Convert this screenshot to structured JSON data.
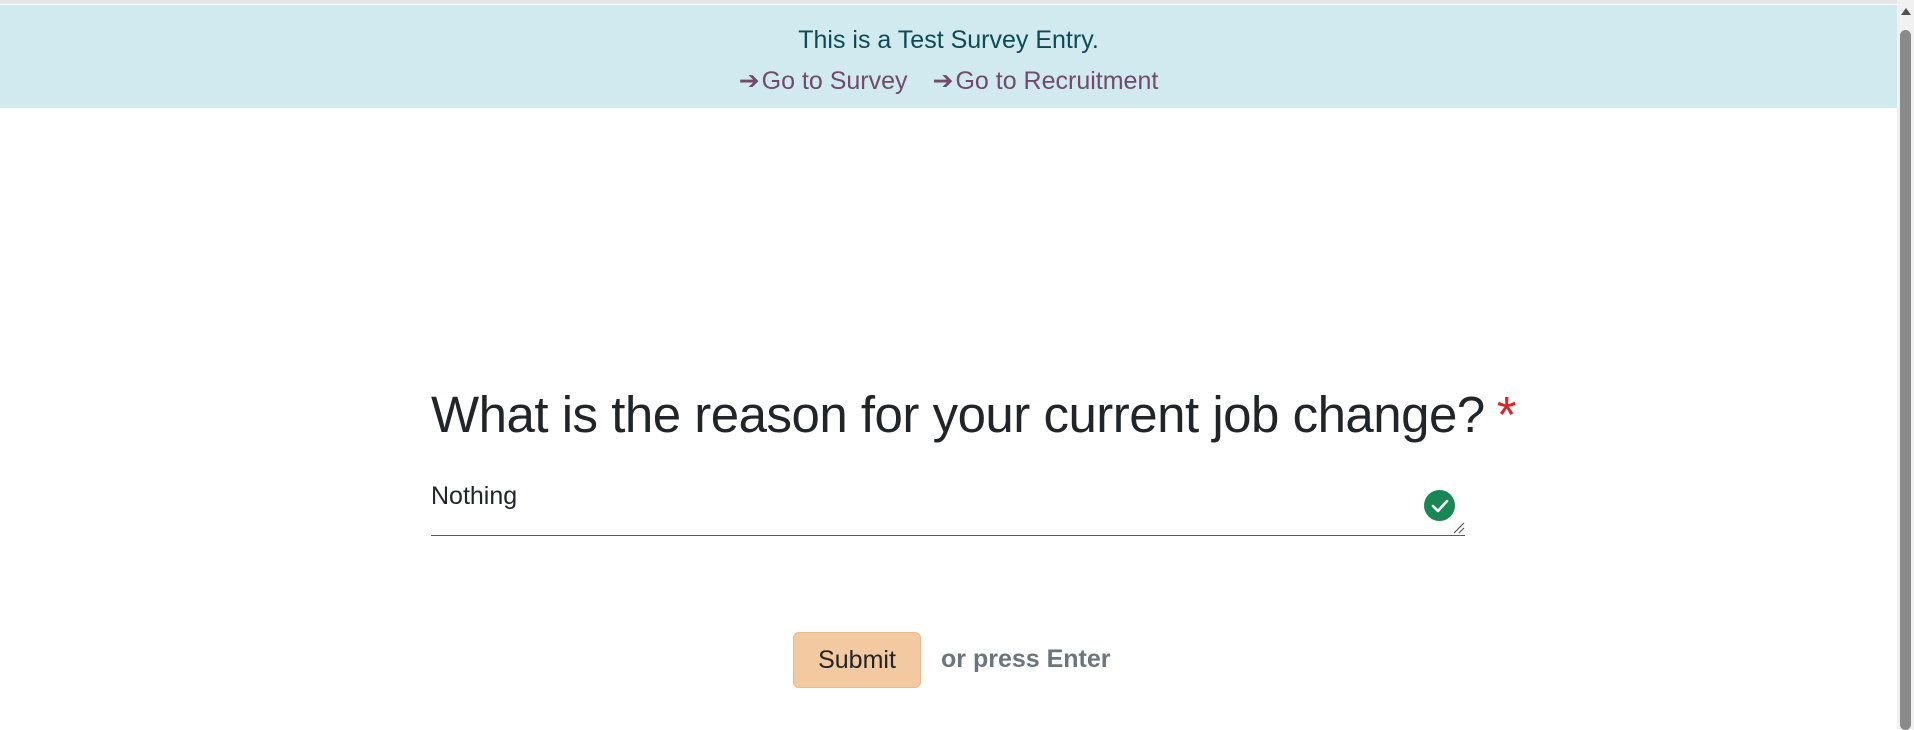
{
  "banner": {
    "message": "This is a Test Survey Entry.",
    "links": [
      {
        "arrow": "➔",
        "label": "Go to Survey"
      },
      {
        "arrow": "➔",
        "label": "Go to Recruitment"
      }
    ]
  },
  "question": {
    "title": "What is the reason for your current job change?",
    "required_mark": "*"
  },
  "answer": {
    "value": "Nothing",
    "status_icon": "check-circle-icon"
  },
  "actions": {
    "submit_label": "Submit",
    "hint": "or press Enter"
  },
  "colors": {
    "banner_bg": "#d1eaef",
    "link": "#714b67",
    "required": "#d9232d",
    "submit_bg": "#f2c9a0",
    "valid": "#198754"
  }
}
